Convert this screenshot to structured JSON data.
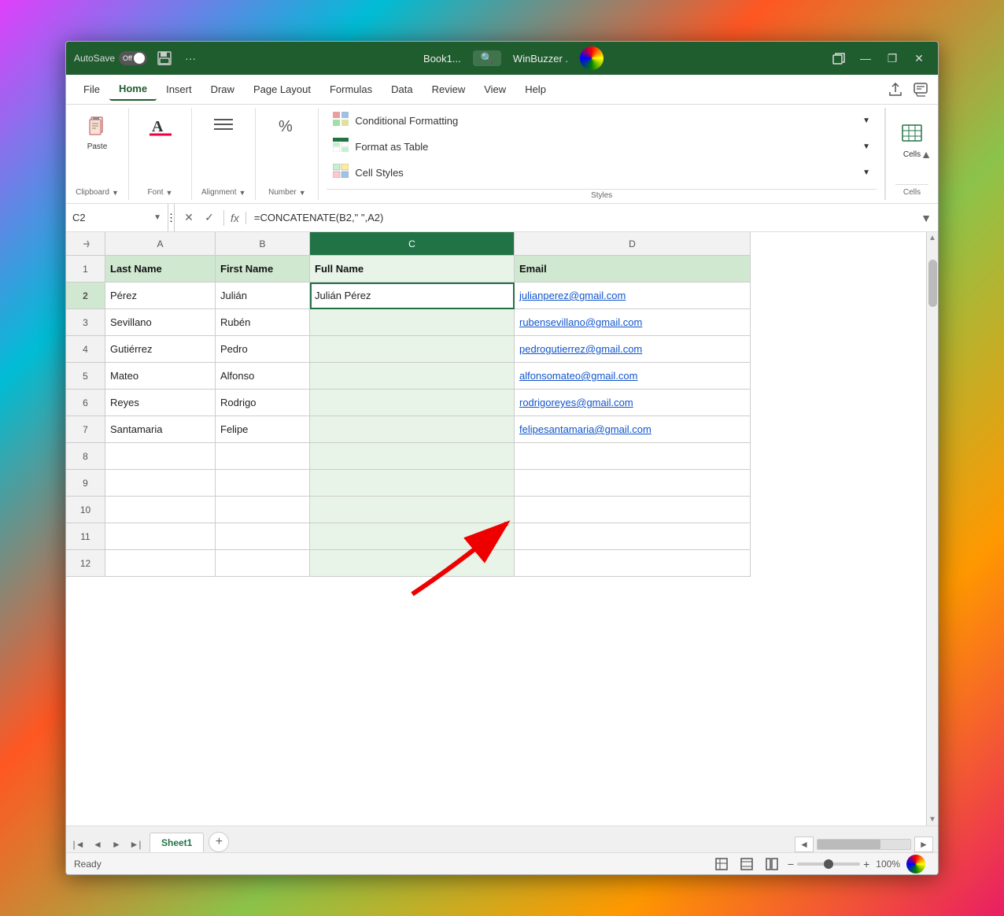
{
  "titlebar": {
    "autosave": "AutoSave",
    "toggle": "Off",
    "title": "Book1...",
    "winbuzzer": "WinBuzzer .",
    "minimize": "—",
    "restore": "❐",
    "close": "✕"
  },
  "menubar": {
    "items": [
      "File",
      "Home",
      "Insert",
      "Draw",
      "Page Layout",
      "Formulas",
      "Data",
      "Review",
      "View",
      "Help"
    ],
    "active": "Home"
  },
  "ribbon": {
    "clipboard_label": "Clipboard",
    "font_label": "Font",
    "alignment_label": "Alignment",
    "number_label": "Number",
    "conditional_formatting": "Conditional Formatting",
    "format_as_table": "Format as Table",
    "cell_styles": "Cell Styles",
    "styles_label": "Styles",
    "cells_label": "Cells"
  },
  "formula_bar": {
    "name_box": "C2",
    "formula": "=CONCATENATE(B2,\" \",A2)"
  },
  "columns": {
    "headers": [
      "A",
      "B",
      "C",
      "D"
    ],
    "labels": [
      "A",
      "B",
      "C",
      "D"
    ]
  },
  "rows": {
    "headers": [
      1,
      2,
      3,
      4,
      5,
      6,
      7,
      8,
      9,
      10,
      11,
      12
    ],
    "data": [
      [
        "Last Name",
        "First Name",
        "Full Name",
        "Email"
      ],
      [
        "Pérez",
        "Julián",
        "Julián Pérez",
        "julianperez@gmail.com"
      ],
      [
        "Sevillano",
        "Rubén",
        "",
        "rubensevillano@gmail.com"
      ],
      [
        "Gutiérrez",
        "Pedro",
        "",
        "pedrogutierrez@gmail.com"
      ],
      [
        "Mateo",
        "Alfonso",
        "",
        "alfonsomateo@gmail.com"
      ],
      [
        "Reyes",
        "Rodrigo",
        "",
        "rodrigoreyes@gmail.com"
      ],
      [
        "Santamaria",
        "Felipe",
        "",
        "felipesantamaria@gmail.com"
      ],
      [
        "",
        "",
        "",
        ""
      ],
      [
        "",
        "",
        "",
        ""
      ],
      [
        "",
        "",
        "",
        ""
      ],
      [
        "",
        "",
        "",
        ""
      ],
      [
        "",
        "",
        "",
        ""
      ]
    ]
  },
  "sheet": {
    "name": "Sheet1"
  },
  "status": {
    "text": "Ready",
    "zoom": "100%"
  }
}
